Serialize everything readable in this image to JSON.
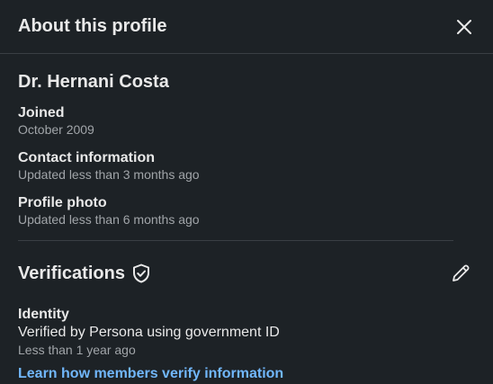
{
  "header": {
    "title": "About this profile"
  },
  "profile": {
    "name": "Dr. Hernani Costa",
    "items": [
      {
        "label": "Joined",
        "sub": "October 2009"
      },
      {
        "label": "Contact information",
        "sub": "Updated less than 3 months ago"
      },
      {
        "label": "Profile photo",
        "sub": "Updated less than 6 months ago"
      }
    ]
  },
  "verifications": {
    "title": "Verifications",
    "identity": {
      "label": "Identity",
      "text": "Verified by Persona using government ID",
      "sub": "Less than 1 year ago"
    },
    "learn_link": "Learn how members verify information"
  },
  "icons": {
    "close": "close-icon",
    "shield": "shield-check-icon",
    "edit": "pencil-icon"
  },
  "colors": {
    "background": "#1d2226",
    "text": "#e9e9e9",
    "muted": "#a1a5a9",
    "link": "#71b7fb",
    "divider": "#3a3f44"
  }
}
